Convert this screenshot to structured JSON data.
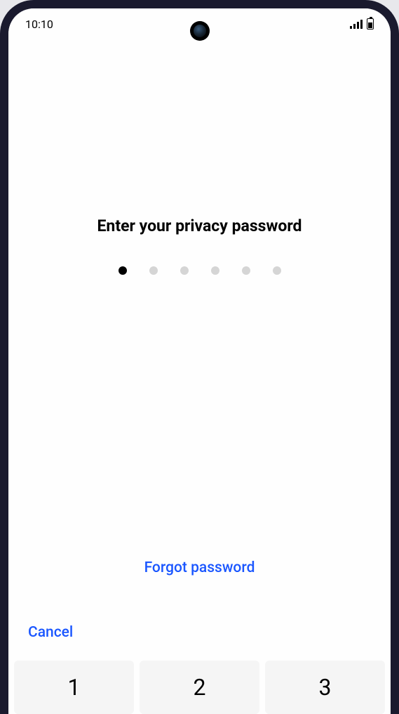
{
  "status_bar": {
    "time": "10:10"
  },
  "prompt": {
    "title": "Enter your privacy password"
  },
  "pin": {
    "total_digits": 6,
    "entered_digits": 1
  },
  "links": {
    "forgot": "Forgot password",
    "cancel": "Cancel"
  },
  "keypad": {
    "keys": [
      "1",
      "2",
      "3"
    ]
  },
  "colors": {
    "accent": "#1a56ff",
    "dot_filled": "#000000",
    "dot_empty": "#d5d5d5",
    "key_bg": "#f5f5f5"
  }
}
